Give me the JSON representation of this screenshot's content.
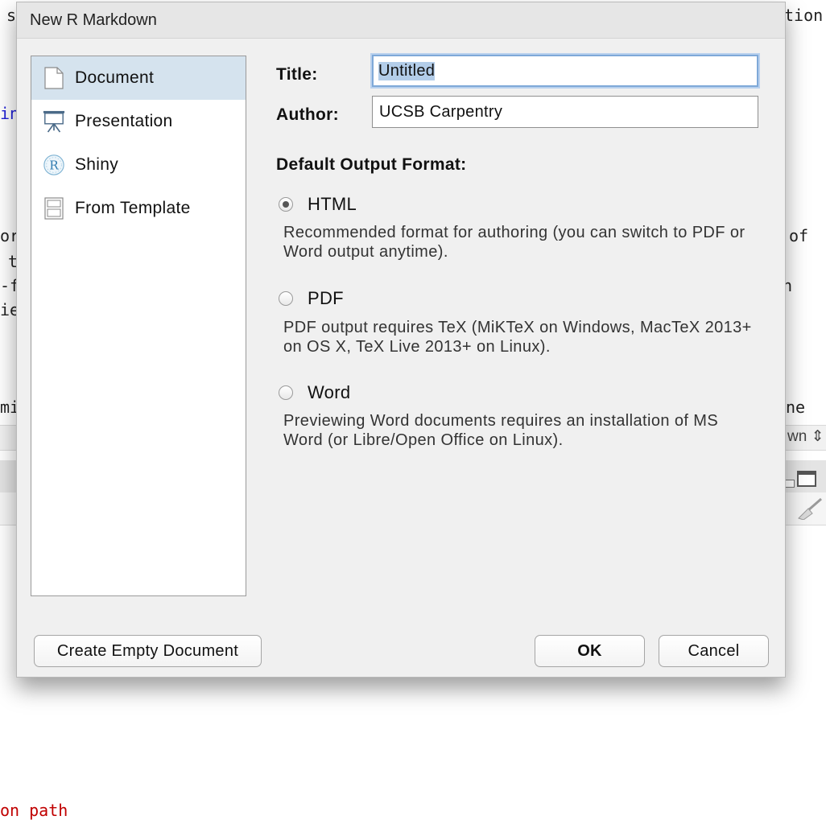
{
  "background": {
    "fragments": [
      "s",
      "tion",
      "in",
      "or",
      "of",
      "t",
      "-f",
      "n",
      "ie",
      "mi",
      "ne",
      "on path"
    ],
    "select_value": "wn"
  },
  "dialog": {
    "title": "New R Markdown",
    "sidebar": {
      "items": [
        {
          "label": "Document",
          "icon": "document-icon",
          "selected": true
        },
        {
          "label": "Presentation",
          "icon": "presentation-icon",
          "selected": false
        },
        {
          "label": "Shiny",
          "icon": "shiny-icon",
          "selected": false
        },
        {
          "label": "From Template",
          "icon": "template-icon",
          "selected": false
        }
      ]
    },
    "form": {
      "title_label": "Title:",
      "title_value": "Untitled",
      "author_label": "Author:",
      "author_value": "UCSB Carpentry",
      "output_format_label": "Default Output Format:",
      "formats": [
        {
          "label": "HTML",
          "checked": true,
          "description": "Recommended format for authoring (you can switch to PDF or Word output anytime)."
        },
        {
          "label": "PDF",
          "checked": false,
          "description": "PDF output requires TeX (MiKTeX on Windows, MacTeX 2013+ on OS X, TeX Live 2013+ on Linux)."
        },
        {
          "label": "Word",
          "checked": false,
          "description": "Previewing Word documents requires an installation of MS Word (or Libre/Open Office on Linux)."
        }
      ]
    },
    "buttons": {
      "create_empty": "Create Empty Document",
      "ok": "OK",
      "cancel": "Cancel"
    }
  },
  "colors": {
    "selection_bg": "#d5e3ee",
    "focus_ring": "#7fa9d8",
    "dialog_bg": "#f0f0f0",
    "code_blue": "#1f1fd6",
    "code_red": "#c00000"
  }
}
